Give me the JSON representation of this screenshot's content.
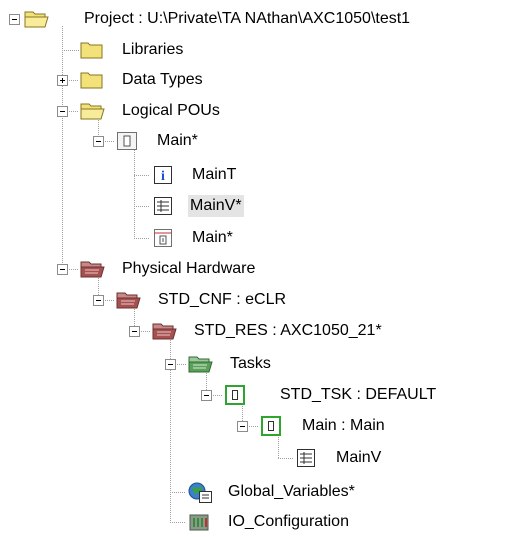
{
  "tree": {
    "root": {
      "label": "Project : U:\\Private\\TA NAthan\\AXC1050\\test1",
      "icon": "open-folder-icon",
      "expanded": true
    },
    "libraries": {
      "label": "Libraries",
      "icon": "folder-icon"
    },
    "data_types": {
      "label": "Data Types",
      "icon": "folder-icon",
      "expanded": false
    },
    "logical_pous": {
      "label": "Logical POUs",
      "icon": "open-folder-icon",
      "expanded": true
    },
    "main_pou": {
      "label": "Main*",
      "icon": "program-icon",
      "expanded": true
    },
    "main_t": {
      "label": "MainT",
      "icon": "info-icon"
    },
    "main_v": {
      "label": "MainV*",
      "icon": "variables-worksheet-icon",
      "selected": true
    },
    "main_code": {
      "label": "Main*",
      "icon": "code-worksheet-icon"
    },
    "physical_hw": {
      "label": "Physical Hardware",
      "icon": "hardware-folder-icon",
      "expanded": true
    },
    "std_cnf": {
      "label": "STD_CNF : eCLR",
      "icon": "hardware-folder-icon",
      "expanded": true
    },
    "std_res": {
      "label": "STD_RES : AXC1050_21*",
      "icon": "hardware-folder-icon",
      "expanded": true
    },
    "tasks": {
      "label": "Tasks",
      "icon": "tasks-folder-icon",
      "expanded": true
    },
    "std_tsk": {
      "label": "STD_TSK : DEFAULT",
      "icon": "task-icon",
      "expanded": true
    },
    "main_instance": {
      "label": "Main : Main",
      "icon": "task-icon",
      "expanded": true
    },
    "instance_main_v": {
      "label": "MainV",
      "icon": "variables-worksheet-icon"
    },
    "global_vars": {
      "label": "Global_Variables*",
      "icon": "global-variables-icon"
    },
    "io_config": {
      "label": "IO_Configuration",
      "icon": "io-configuration-icon"
    }
  },
  "colors": {
    "folder_yellow": "#f3e27a",
    "folder_outline": "#8a7420",
    "hardware_red": "#a85050",
    "tasks_green": "#5aa05a",
    "task_border_green": "#2fa52f",
    "selection_bg": "#e4e4e4",
    "tree_line": "#a0a0a0"
  }
}
